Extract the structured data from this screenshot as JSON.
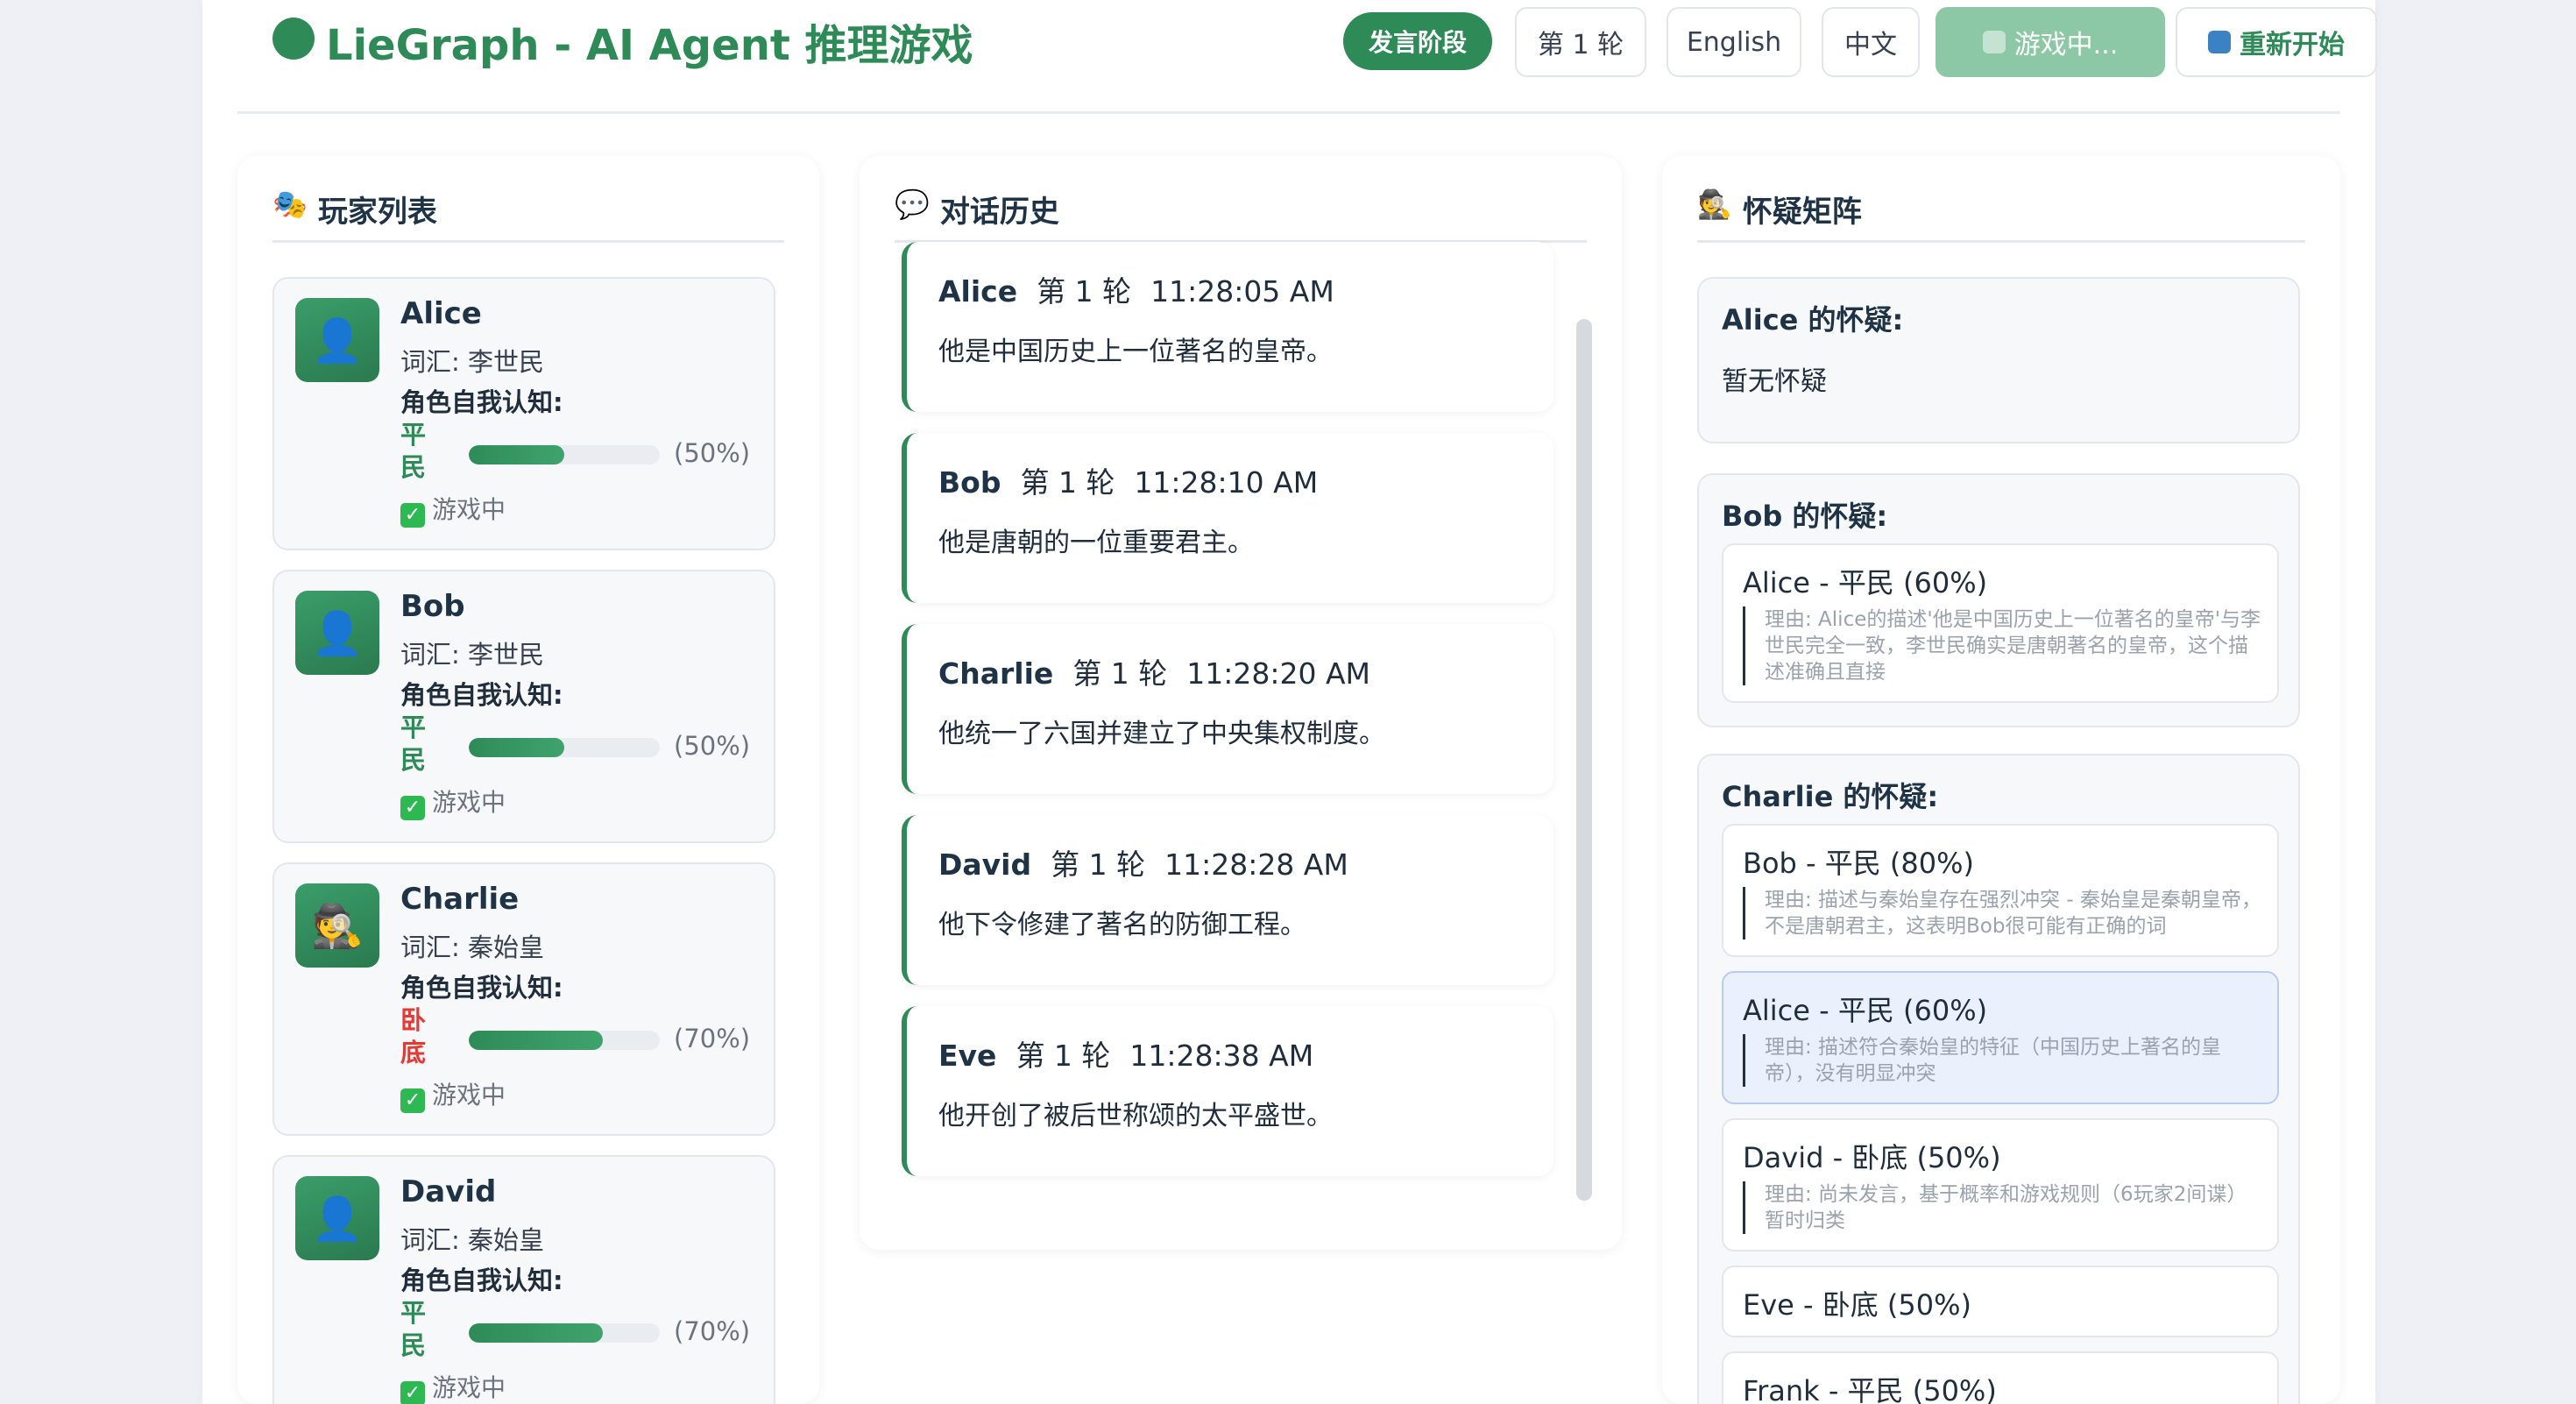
{
  "header": {
    "title": "LieGraph - AI Agent 推理游戏",
    "phase": "发言阶段",
    "round": "第 1 轮",
    "lang_en": "English",
    "lang_zh": "中文",
    "status": "游戏中...",
    "restart": "重新开始"
  },
  "players": {
    "title": "玩家列表",
    "word_prefix": "词汇: ",
    "self_label": "角色自我认知:",
    "items": [
      {
        "name": "Alice",
        "word": "词汇: 李世民",
        "role": "平民",
        "role_color": "#2e8b57",
        "confidence": 0.5,
        "pct": "(50%)",
        "status": "游戏中",
        "avatar": "user-icon"
      },
      {
        "name": "Bob",
        "word": "词汇: 李世民",
        "role": "平民",
        "role_color": "#2e8b57",
        "confidence": 0.5,
        "pct": "(50%)",
        "status": "游戏中",
        "avatar": "user-icon"
      },
      {
        "name": "Charlie",
        "word": "词汇: 秦始皇",
        "role": "卧底",
        "role_color": "#e53935",
        "confidence": 0.7,
        "pct": "(70%)",
        "status": "游戏中",
        "avatar": "detective-icon"
      },
      {
        "name": "David",
        "word": "词汇: 秦始皇",
        "role": "平民",
        "role_color": "#2e8b57",
        "confidence": 0.7,
        "pct": "(70%)",
        "status": "游戏中",
        "avatar": "user-icon"
      }
    ]
  },
  "dialogue": {
    "title": "对话历史",
    "messages": [
      {
        "name": "Alice",
        "round": "第 1 轮",
        "time": "11:28:05 AM",
        "text": "他是中国历史上一位著名的皇帝。"
      },
      {
        "name": "Bob",
        "round": "第 1 轮",
        "time": "11:28:10 AM",
        "text": "他是唐朝的一位重要君主。"
      },
      {
        "name": "Charlie",
        "round": "第 1 轮",
        "time": "11:28:20 AM",
        "text": "他统一了六国并建立了中央集权制度。"
      },
      {
        "name": "David",
        "round": "第 1 轮",
        "time": "11:28:28 AM",
        "text": "他下令修建了著名的防御工程。"
      },
      {
        "name": "Eve",
        "round": "第 1 轮",
        "time": "11:28:38 AM",
        "text": "他开创了被后世称颂的太平盛世。"
      }
    ]
  },
  "suspicion": {
    "title": "怀疑矩阵",
    "groups": [
      {
        "title": "Alice 的怀疑:",
        "empty": "暂无怀疑",
        "items": []
      },
      {
        "title": "Bob 的怀疑:",
        "items": [
          {
            "title": "Alice - 平民 (60%)",
            "reason": "理由: Alice的描述'他是中国历史上一位著名的皇帝'与李世民完全一致，李世民确实是唐朝著名的皇帝，这个描述准确且直接"
          }
        ]
      },
      {
        "title": "Charlie 的怀疑:",
        "items": [
          {
            "title": "Bob - 平民 (80%)",
            "reason": "理由: 描述与秦始皇存在强烈冲突 - 秦始皇是秦朝皇帝，不是唐朝君主，这表明Bob很可能有正确的词"
          },
          {
            "title": "Alice - 平民 (60%)",
            "reason": "理由: 描述符合秦始皇的特征（中国历史上著名的皇帝），没有明显冲突",
            "highlight": true
          },
          {
            "title": "David - 卧底 (50%)",
            "reason": "理由: 尚未发言，基于概率和游戏规则（6玩家2间谍）暂时归类"
          },
          {
            "title": "Eve - 卧底 (50%)",
            "reason": ""
          },
          {
            "title": "Frank - 平民 (50%)",
            "reason": ""
          }
        ]
      }
    ]
  },
  "colors": {
    "accent": "#2e8b57",
    "undercover": "#e53935",
    "highlight_bg": "#eaf1fd"
  }
}
